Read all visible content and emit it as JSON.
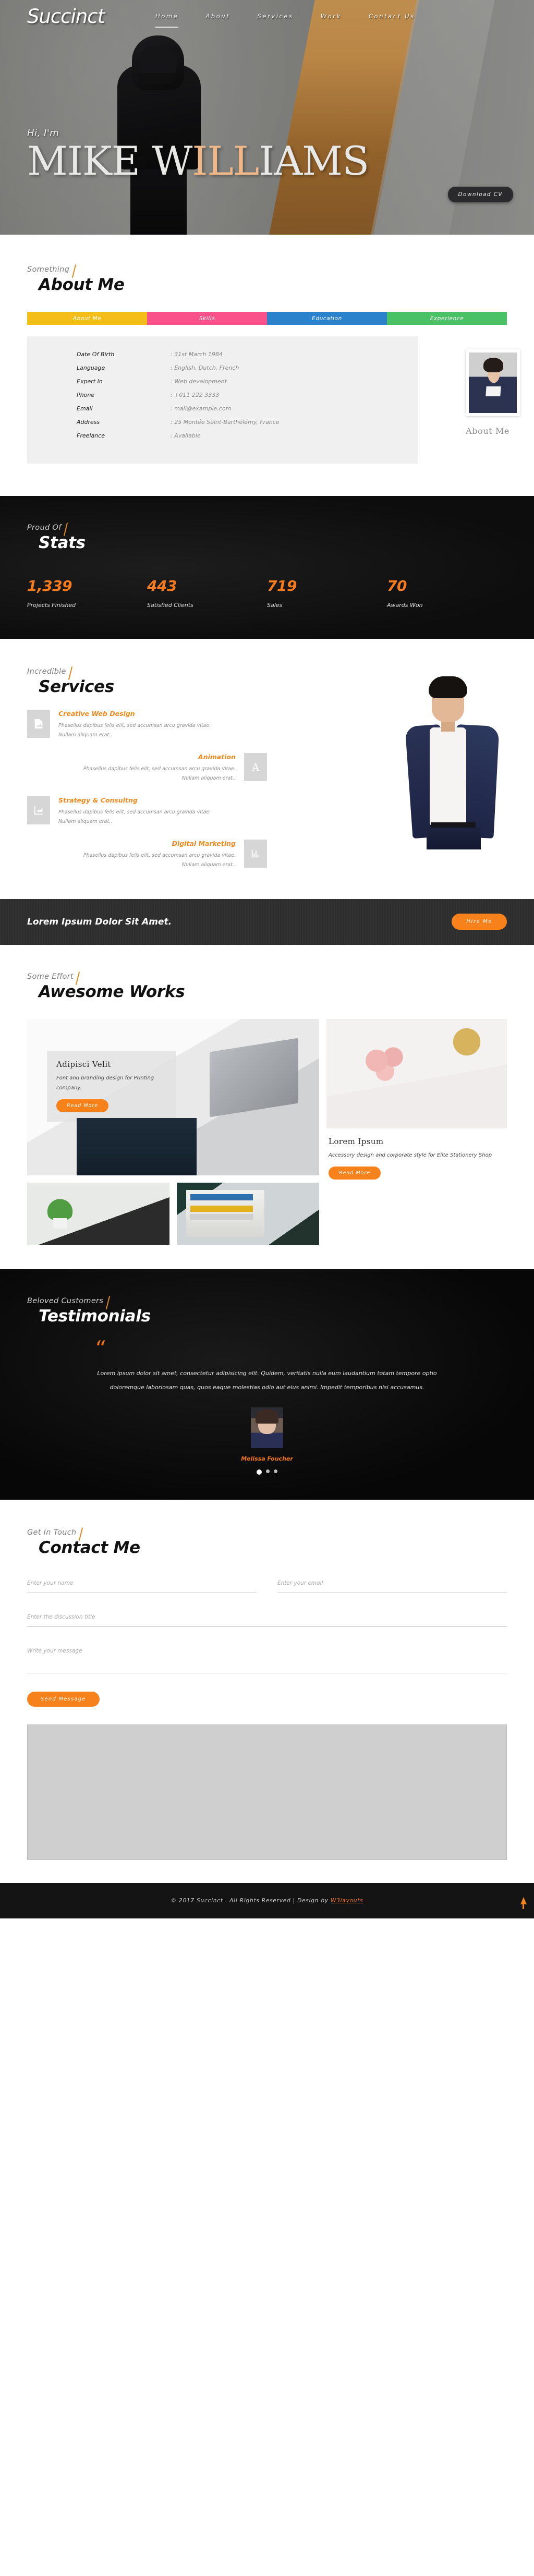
{
  "header": {
    "brand": "Succinct",
    "nav": [
      {
        "label": "Home",
        "active": true
      },
      {
        "label": "About",
        "active": false
      },
      {
        "label": "Services",
        "active": false
      },
      {
        "label": "Work",
        "active": false
      },
      {
        "label": "Contact Us",
        "active": false
      }
    ]
  },
  "hero": {
    "greeting": "Hi, I'm",
    "name_part1": "M",
    "name_part2": "IKE ",
    "name_part3": "W",
    "name_part4": "I",
    "name_part5": "LL",
    "name_part6": "IAMS",
    "name_full": "MIKE WILLIAMS",
    "cv_button": "Download CV",
    "accent_color": "#f0b887"
  },
  "about": {
    "eyebrow": "Something",
    "heading": "About Me",
    "tabs": [
      {
        "label": "About Me",
        "color": "#f5bd17"
      },
      {
        "label": "Skills",
        "color": "#f9528a"
      },
      {
        "label": "Education",
        "color": "#2a81cc"
      },
      {
        "label": "Experience",
        "color": "#49c266"
      }
    ],
    "details": [
      {
        "key": "Date Of Birth",
        "value": ": 31st March 1984"
      },
      {
        "key": "Language",
        "value": ": English, Dutch, French"
      },
      {
        "key": "Expert In",
        "value": ": Web development"
      },
      {
        "key": "Phone",
        "value": ": +011 222 3333"
      },
      {
        "key": "Email",
        "value": ": mail@example.com"
      },
      {
        "key": "Address",
        "value": ": 25 Montée Saint-Barthélémy, France"
      },
      {
        "key": "Freelance",
        "value": ": Available"
      }
    ],
    "photo_caption": "About Me"
  },
  "stats": {
    "eyebrow": "Proud Of",
    "heading": "Stats",
    "accent_color": "#f47b20",
    "items": [
      {
        "number": "1,339",
        "label": "Projects Finished"
      },
      {
        "number": "443",
        "label": "Satisfied Clients"
      },
      {
        "number": "719",
        "label": "Sales"
      },
      {
        "number": "70",
        "label": "Awards Won"
      }
    ]
  },
  "services": {
    "eyebrow": "Incredible",
    "heading": "Services",
    "accent_color": "#f08a1e",
    "items": [
      {
        "title": "Creative Web Design",
        "text": "Phasellus dapibus felis elit, sed accumsan arcu gravida vitae. Nullam aliquam erat..",
        "icon": "image-file-icon",
        "align": "left"
      },
      {
        "title": "Animation",
        "text": "Phasellus dapibus felis elit, sed accumsan arcu gravida vitae. Nullam aliquam erat..",
        "icon": "letter-a-icon",
        "align": "right"
      },
      {
        "title": "Strategy & Consultng",
        "text": "Phasellus dapibus felis elit, sed accumsan arcu gravida vitae. Nullam aliquam erat..",
        "icon": "chart-up-icon",
        "align": "left"
      },
      {
        "title": "Digital Marketing",
        "text": "Phasellus dapibus felis elit, sed accumsan arcu gravida vitae. Nullam aliquam erat..",
        "icon": "bar-chart-icon",
        "align": "right"
      }
    ]
  },
  "cta": {
    "text": "Lorem Ipsum Dolor Sit Amet.",
    "button": "Hire Me",
    "button_color": "#f7821b"
  },
  "works": {
    "eyebrow": "Some Effort",
    "heading": "Awesome Works",
    "card_left": {
      "title": "Adipisci Velit",
      "desc": "Font and branding design for Printing company.",
      "button": "Read More"
    },
    "card_right": {
      "title": "Lorem Ipsum",
      "desc": "Accessory design and corporate style for Elite Stationery Shop",
      "button": "Read More"
    }
  },
  "testimonials": {
    "eyebrow": "Beloved Customers",
    "heading": "Testimonials",
    "quote_glyph": "“",
    "quote": "Lorem ipsum dolor sit amet, consectetur adipisicing elit. Quidem, veritatis nulla eum laudantium totam tempore optio doloremque laboriosam quas, quos eaque molestias odio aut eius animi. Impedit temporibus nisi accusamus.",
    "author": "Melissa Foucher",
    "dots": 3,
    "active_dot": 0,
    "accent_color": "#f4761c"
  },
  "contact": {
    "eyebrow": "Get In Touch",
    "heading": "Contact Me",
    "name_placeholder": "Enter your name",
    "email_placeholder": "Enter your email",
    "subject_placeholder": "Enter the discussion title",
    "message_placeholder": "Write your message",
    "send_button": "Send Message"
  },
  "footer": {
    "copyright": "© 2017 Succinct . All Rights Reserved | Design by",
    "link": "W3layouts",
    "link_color": "#f4761c"
  }
}
